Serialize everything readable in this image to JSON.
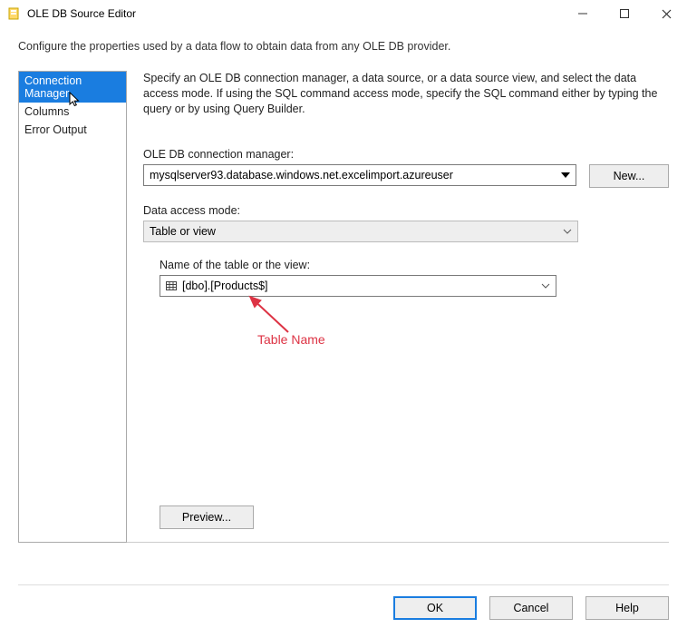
{
  "window": {
    "title": "OLE DB Source Editor"
  },
  "instruction": "Configure the properties used by a data flow to obtain data from any OLE DB provider.",
  "sidebar": {
    "items": [
      {
        "label": "Connection Manager",
        "selected": true
      },
      {
        "label": "Columns",
        "selected": false
      },
      {
        "label": "Error Output",
        "selected": false
      }
    ]
  },
  "content": {
    "description": "Specify an OLE DB connection manager, a data source, or a data source view, and select the data access mode. If using the SQL command access mode, specify the SQL command either by typing the query or by using Query Builder.",
    "conn_label": "OLE DB connection manager:",
    "conn_value": "mysqlserver93.database.windows.net.excelimport.azureuser",
    "new_label": "New...",
    "mode_label": "Data access mode:",
    "mode_value": "Table or view",
    "table_label": "Name of the table or the view:",
    "table_value": "[dbo].[Products$]",
    "preview_label": "Preview..."
  },
  "buttons": {
    "ok": "OK",
    "cancel": "Cancel",
    "help": "Help"
  },
  "annotation": {
    "label": "Table Name"
  }
}
